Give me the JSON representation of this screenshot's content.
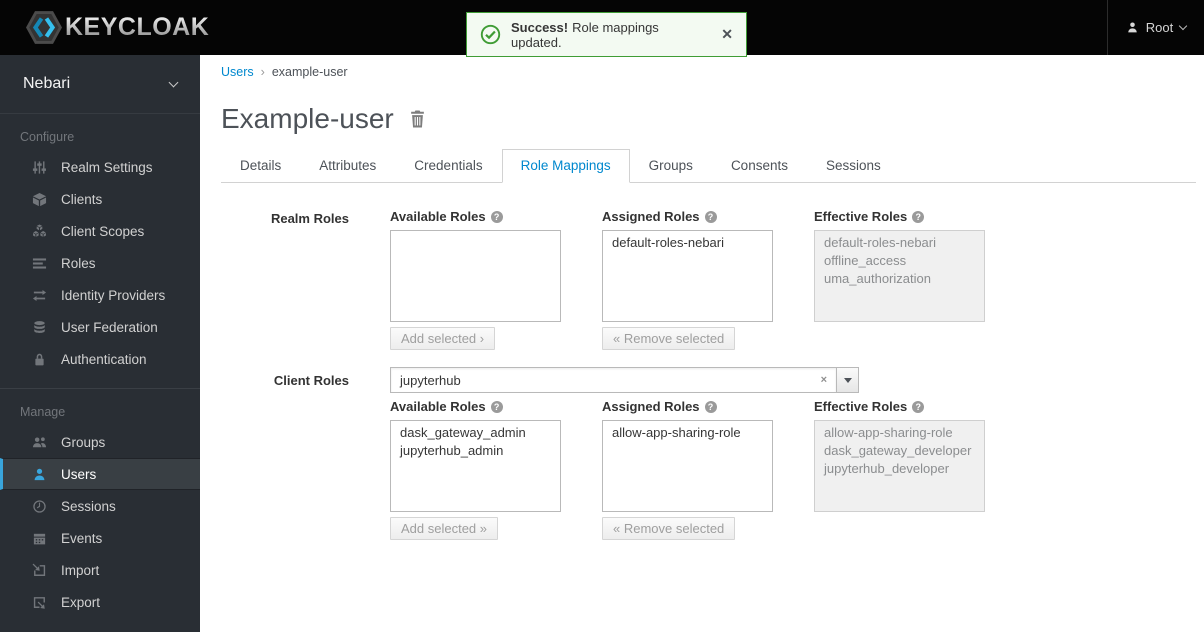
{
  "colors": {
    "accent": "#0088ce",
    "sidebar_active": "#39a5dc",
    "success": "#3f9c35"
  },
  "topbar": {
    "logo_text": "KEYCLOAK",
    "user_label": "Root"
  },
  "notification": {
    "title": "Success!",
    "message": "Role mappings updated.",
    "close_glyph": "✕"
  },
  "sidebar": {
    "realm": "Nebari",
    "sections": [
      {
        "label": "Configure",
        "items": [
          {
            "label": "Realm Settings",
            "icon": "sliders-icon",
            "active": false
          },
          {
            "label": "Clients",
            "icon": "cube-icon",
            "active": false
          },
          {
            "label": "Client Scopes",
            "icon": "cubes-icon",
            "active": false
          },
          {
            "label": "Roles",
            "icon": "list-icon",
            "active": false
          },
          {
            "label": "Identity Providers",
            "icon": "exchange-icon",
            "active": false
          },
          {
            "label": "User Federation",
            "icon": "database-icon",
            "active": false
          },
          {
            "label": "Authentication",
            "icon": "lock-icon",
            "active": false
          }
        ]
      },
      {
        "label": "Manage",
        "items": [
          {
            "label": "Groups",
            "icon": "users-icon",
            "active": false
          },
          {
            "label": "Users",
            "icon": "user-icon",
            "active": true
          },
          {
            "label": "Sessions",
            "icon": "clock-icon",
            "active": false
          },
          {
            "label": "Events",
            "icon": "calendar-icon",
            "active": false
          },
          {
            "label": "Import",
            "icon": "import-icon",
            "active": false
          },
          {
            "label": "Export",
            "icon": "export-icon",
            "active": false
          }
        ]
      }
    ]
  },
  "main": {
    "breadcrumb": {
      "parent": "Users",
      "separator": "›",
      "current": "example-user"
    },
    "title": "Example-user",
    "tabs": [
      {
        "label": "Details",
        "active": false
      },
      {
        "label": "Attributes",
        "active": false
      },
      {
        "label": "Credentials",
        "active": false
      },
      {
        "label": "Role Mappings",
        "active": true
      },
      {
        "label": "Groups",
        "active": false
      },
      {
        "label": "Consents",
        "active": false
      },
      {
        "label": "Sessions",
        "active": false
      }
    ],
    "help_glyph": "?",
    "realm_roles": {
      "row_label": "Realm Roles",
      "available": {
        "header": "Available Roles",
        "items": [],
        "button": "Add selected ›"
      },
      "assigned": {
        "header": "Assigned Roles",
        "items": [
          "default-roles-nebari"
        ],
        "button": "« Remove selected"
      },
      "effective": {
        "header": "Effective Roles",
        "items": [
          "default-roles-nebari",
          "offline_access",
          "uma_authorization"
        ]
      }
    },
    "client_roles": {
      "row_label": "Client Roles",
      "client_select": {
        "value": "jupyterhub",
        "clear_glyph": "×"
      },
      "available": {
        "header": "Available Roles",
        "items": [
          "dask_gateway_admin",
          "jupyterhub_admin"
        ],
        "button": "Add selected »"
      },
      "assigned": {
        "header": "Assigned Roles",
        "items": [
          "allow-app-sharing-role"
        ],
        "button": "« Remove selected"
      },
      "effective": {
        "header": "Effective Roles",
        "items": [
          "allow-app-sharing-role",
          "dask_gateway_developer",
          "jupyterhub_developer"
        ]
      }
    }
  }
}
